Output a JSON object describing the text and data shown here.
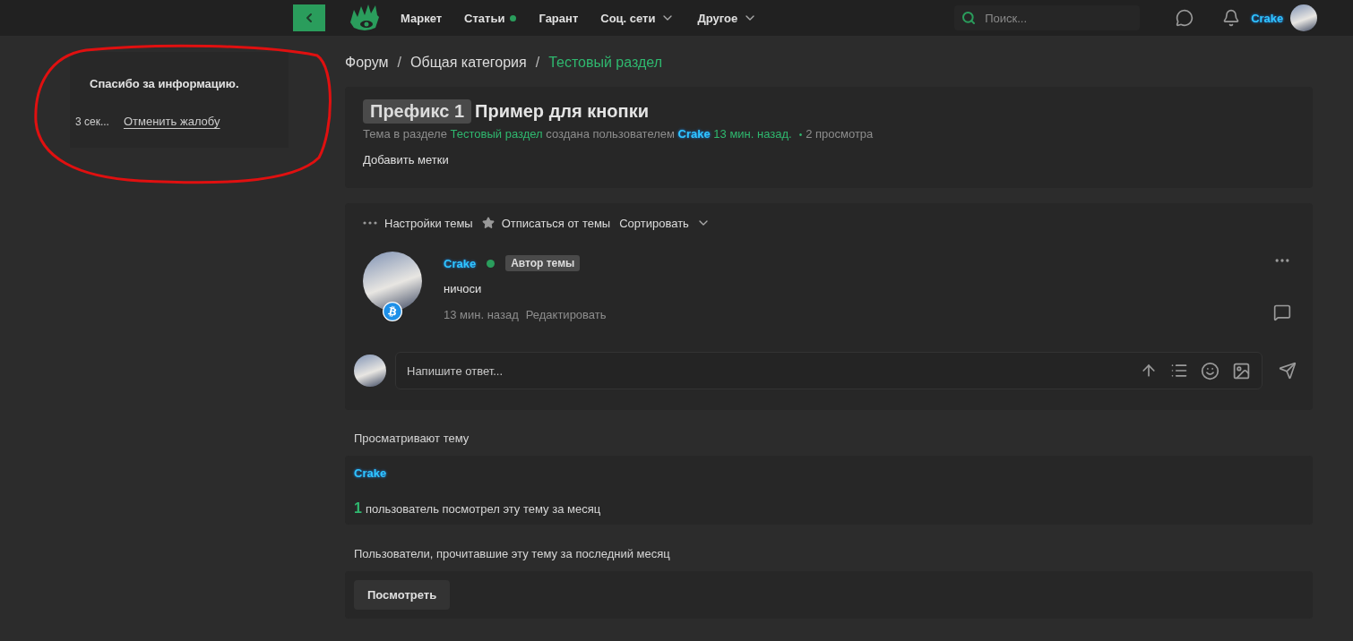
{
  "nav": {
    "items": [
      {
        "label": "Маркет",
        "dot": false,
        "has_menu": false
      },
      {
        "label": "Статьи",
        "dot": true,
        "has_menu": false
      },
      {
        "label": "Гарант",
        "dot": false,
        "has_menu": false
      },
      {
        "label": "Соц. сети",
        "dot": false,
        "has_menu": true
      },
      {
        "label": "Другое",
        "dot": false,
        "has_menu": true
      }
    ],
    "search": {
      "placeholder": "Поиск..."
    },
    "user": {
      "name": "Crake"
    }
  },
  "toast": {
    "message": "Спасибо за информацию.",
    "countdown": "3 сек...",
    "action": "Отменить жалобу"
  },
  "breadcrumbs": [
    {
      "label": "Форум",
      "selected": false
    },
    {
      "separator": "/",
      "label": "Общая категория",
      "selected": false
    },
    {
      "separator": "/",
      "label": "Тестовый раздел",
      "selected": true
    }
  ],
  "thread": {
    "prefix": "Префикс 1",
    "title": "Пример для кнопки",
    "meta_start": "Тема в разделе",
    "section": "Тестовый раздел",
    "meta_mid": "создана пользователем",
    "author": "Crake",
    "time": "13 мин. назад.",
    "views_bullet": "•",
    "views": "2 просмотра",
    "tags_button": "Добавить метки"
  },
  "toolbar": [
    {
      "kind": "dots",
      "label": "Настройки темы"
    },
    {
      "kind": "star",
      "label": "Отписаться от темы"
    },
    {
      "kind": "sort",
      "label": "Сортировать"
    }
  ],
  "post": {
    "author": "Crake",
    "online": true,
    "badge": "Автор темы",
    "text": "ничоси",
    "time": "13 мин. назад",
    "edit": "Редактировать"
  },
  "reply": {
    "placeholder": "Напишите ответ..."
  },
  "viewers": {
    "heading": "Просматривают тему",
    "names": [
      "Crake"
    ],
    "count": "1",
    "count_text": "пользователь посмотрел эту тему за месяц"
  },
  "readers": {
    "heading": "Пользователи, прочитавшие эту тему за последний месяц",
    "button": "Посмотреть"
  }
}
